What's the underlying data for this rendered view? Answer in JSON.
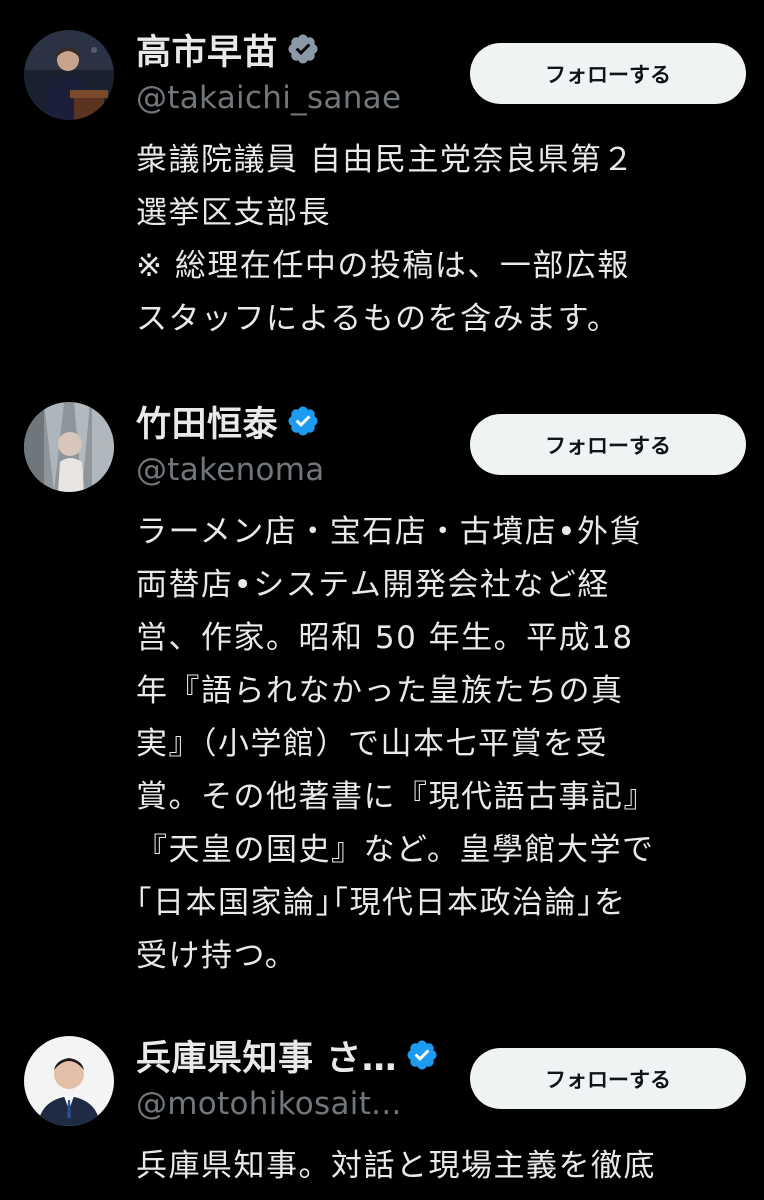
{
  "users": [
    {
      "display_name": "高市早苗",
      "handle": "@takaichi_sanae",
      "follow_label": "フォローする",
      "verified_color": "#8b98a5",
      "bio_lines": [
        "衆議院議員 自由民主党奈良県第２",
        "選挙区支部長",
        "※ 総理在任中の投稿は、一部広報",
        "スタッフによるものを含みます。"
      ]
    },
    {
      "display_name": "竹田恒泰",
      "handle": "@takenoma",
      "follow_label": "フォローする",
      "verified_color": "#1d9bf0",
      "bio_lines": [
        "ラーメン店・宝石店・古墳店•外貨",
        "両替店•システム開発会社など経",
        "営、作家。昭和 50 年生。平成18",
        "年『語られなかった皇族たちの真",
        "実』（小学館）で山本七平賞を受",
        "賞。その他著書に『現代語古事記』",
        "『天皇の国史』など。皇學館大学で",
        "｢日本国家論｣｢現代日本政治論｣を",
        "受け持つ。"
      ]
    },
    {
      "display_name": "兵庫県知事 さ…",
      "handle": "@motohikosait...",
      "follow_label": "フォローする",
      "verified_color": "#1d9bf0",
      "bio_lines": [
        "兵庫県知事。対話と現場主義を徹底"
      ]
    }
  ]
}
